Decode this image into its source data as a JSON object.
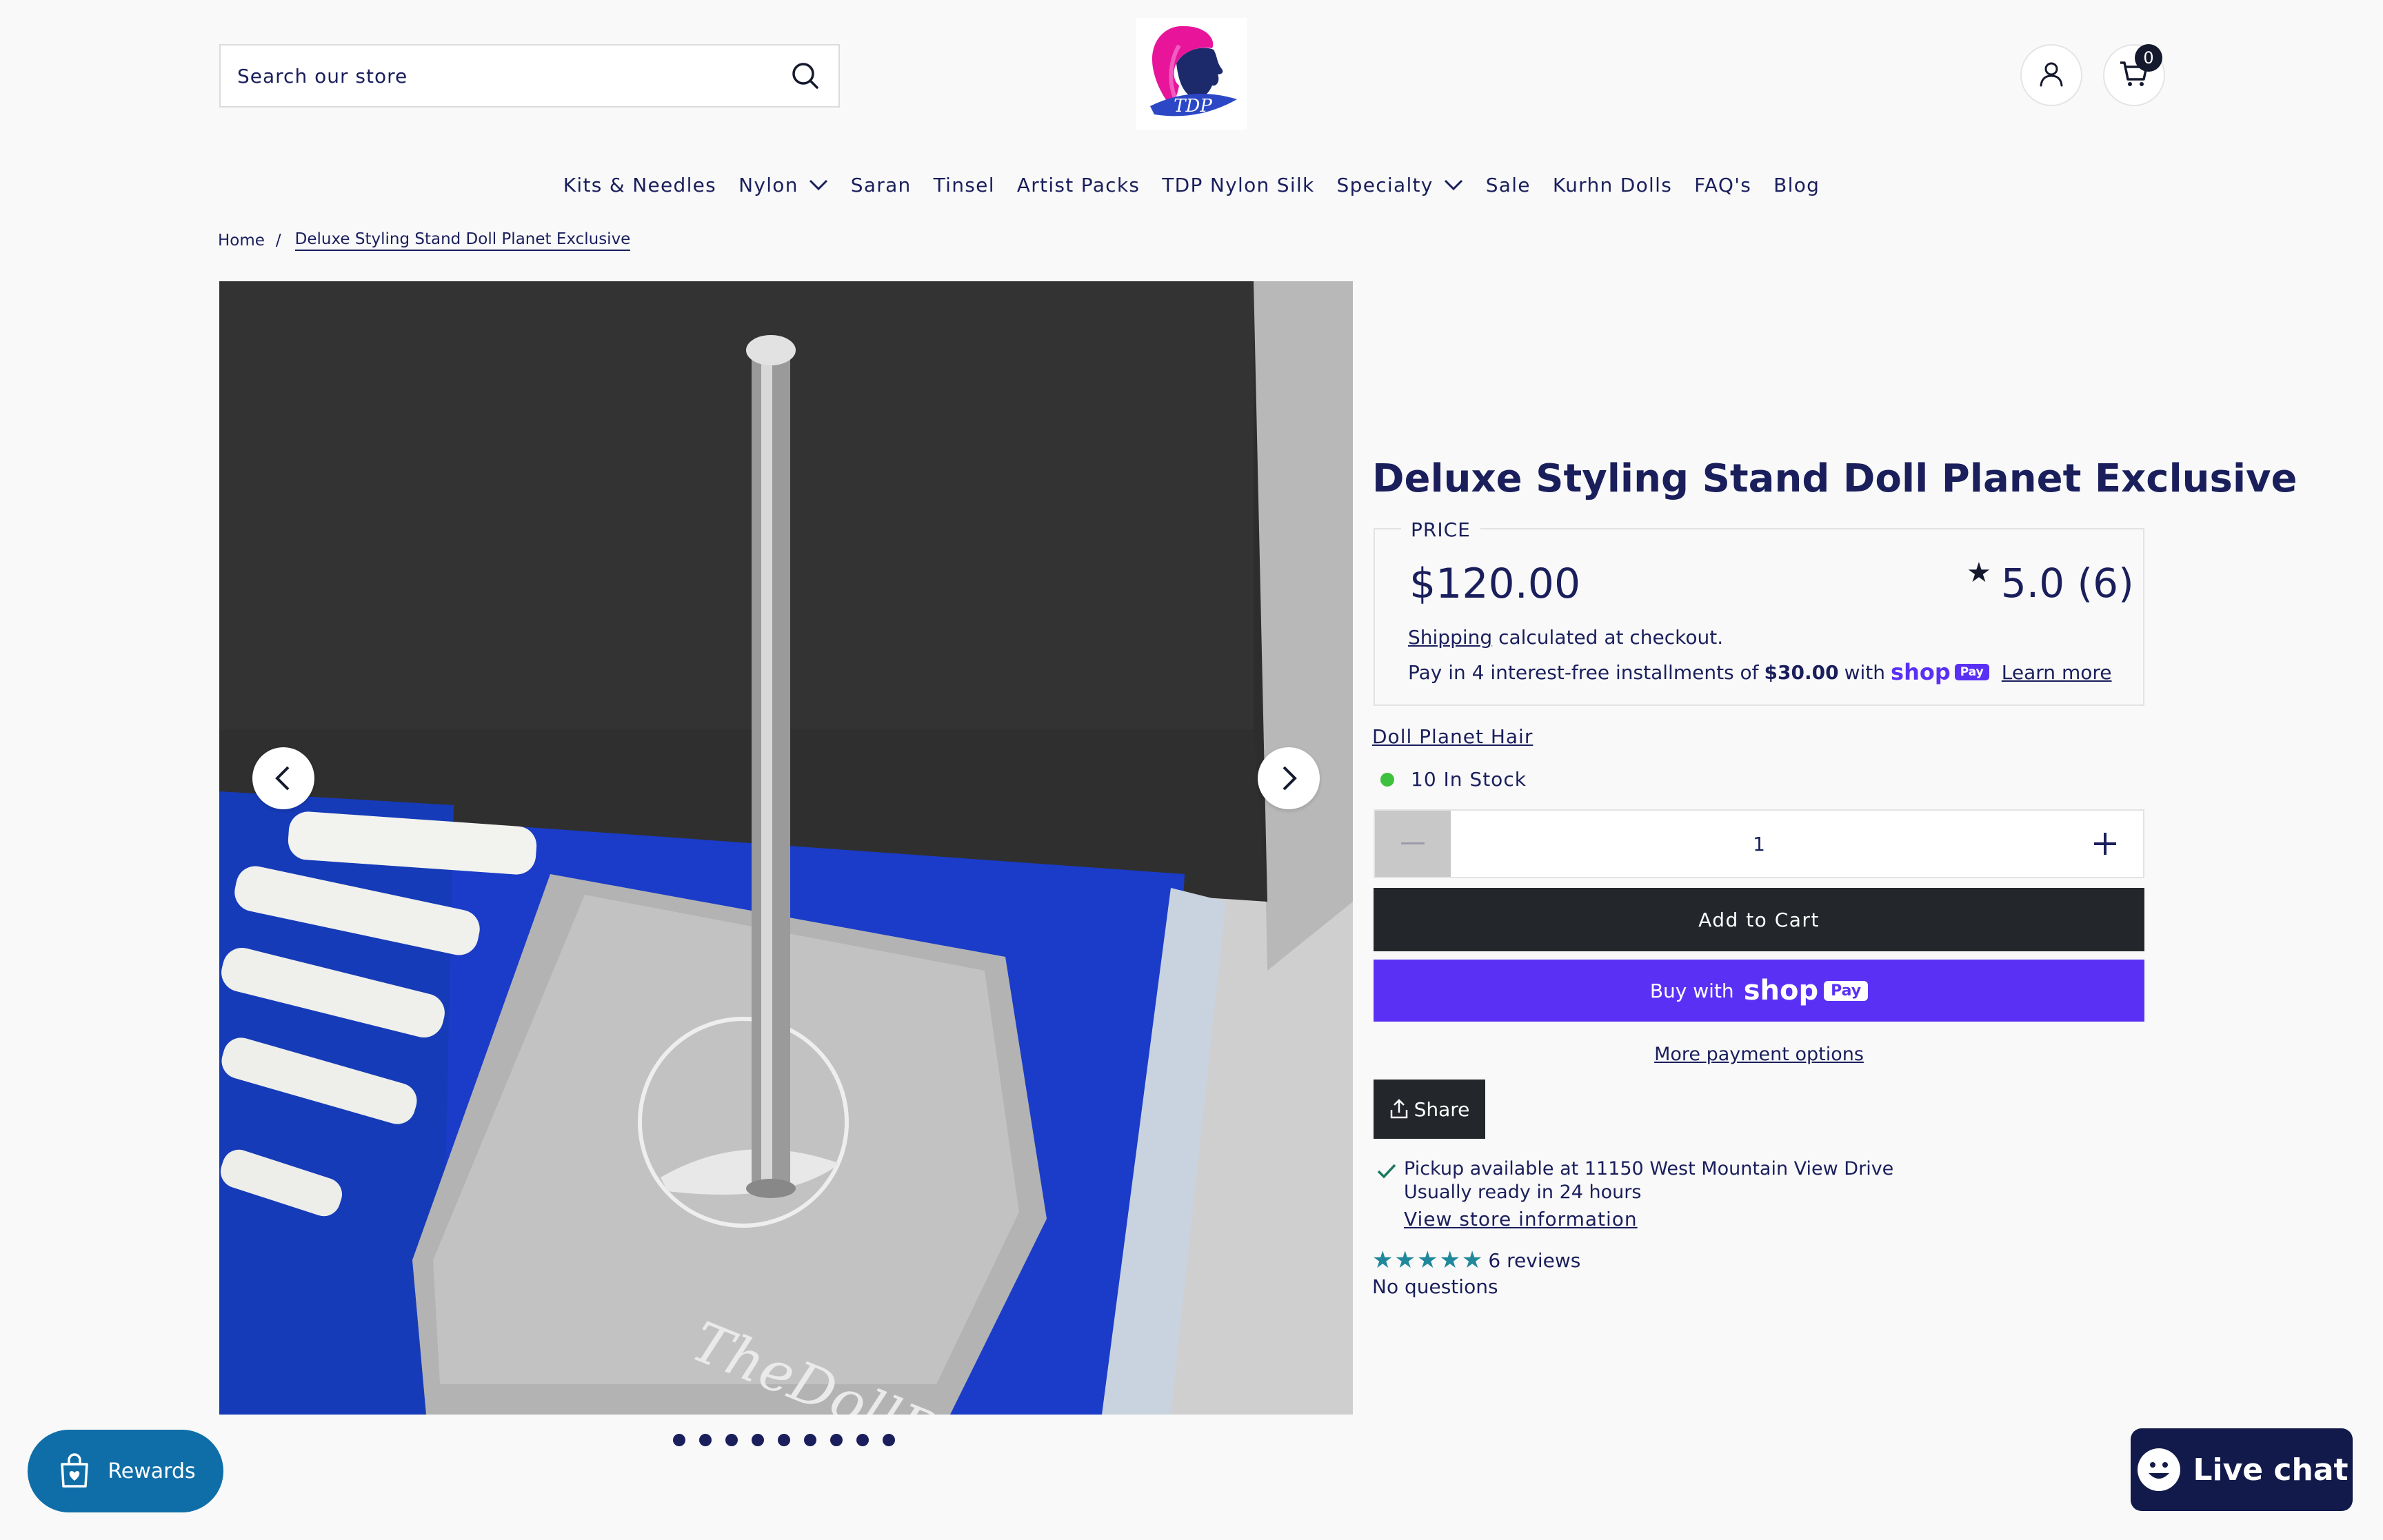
{
  "header": {
    "search_placeholder": "Search our store",
    "cart_count": "0"
  },
  "nav": {
    "items": [
      {
        "label": "Kits & Needles",
        "has_dropdown": false
      },
      {
        "label": "Nylon",
        "has_dropdown": true
      },
      {
        "label": "Saran",
        "has_dropdown": false
      },
      {
        "label": "Tinsel",
        "has_dropdown": false
      },
      {
        "label": "Artist Packs",
        "has_dropdown": false
      },
      {
        "label": "TDP Nylon Silk",
        "has_dropdown": false
      },
      {
        "label": "Specialty",
        "has_dropdown": true
      },
      {
        "label": "Sale",
        "has_dropdown": false
      },
      {
        "label": "Kurhn Dolls",
        "has_dropdown": false
      },
      {
        "label": "FAQ's",
        "has_dropdown": false
      },
      {
        "label": "Blog",
        "has_dropdown": false
      }
    ]
  },
  "breadcrumb": {
    "home": "Home",
    "separator": "/",
    "current": "Deluxe Styling Stand Doll Planet Exclusive"
  },
  "gallery": {
    "image_text": "TheDollPlanet.com",
    "logo_text": "TDP",
    "slide_count": 9,
    "active_slide": 1
  },
  "product": {
    "title": "Deluxe Styling Stand Doll Planet Exclusive",
    "price_label": "PRICE",
    "price": "$120.00",
    "rating": "5.0 (6)",
    "shipping_link": "Shipping",
    "shipping_rest": "calculated at checkout.",
    "installments_prefix": "Pay in 4 interest-free installments of",
    "installments_amount": "$30.00",
    "installments_with": "with",
    "shop_word": "shop",
    "pay_word": "Pay",
    "learn_more": "Learn more",
    "vendor": "Doll Planet Hair",
    "stock": "10 In Stock",
    "quantity": "1",
    "add_to_cart": "Add to Cart",
    "buy_with": "Buy with",
    "more_payment_options": "More payment options",
    "share": "Share",
    "pickup_title": "Pickup available at 11150 West Mountain View Drive",
    "pickup_sub": "Usually ready in 24 hours",
    "pickup_link": "View store information",
    "reviews": "6 reviews",
    "questions": "No questions"
  },
  "widgets": {
    "rewards": "Rewards",
    "live_chat": "Live chat"
  },
  "colors": {
    "navy": "#1a1f5c",
    "shop_purple": "#5a31f4",
    "button_dark": "#23262b",
    "stock_green": "#3ec13e",
    "review_teal": "#21889c",
    "rewards_blue": "#0f6ea8",
    "chat_navy": "#111a4a"
  }
}
